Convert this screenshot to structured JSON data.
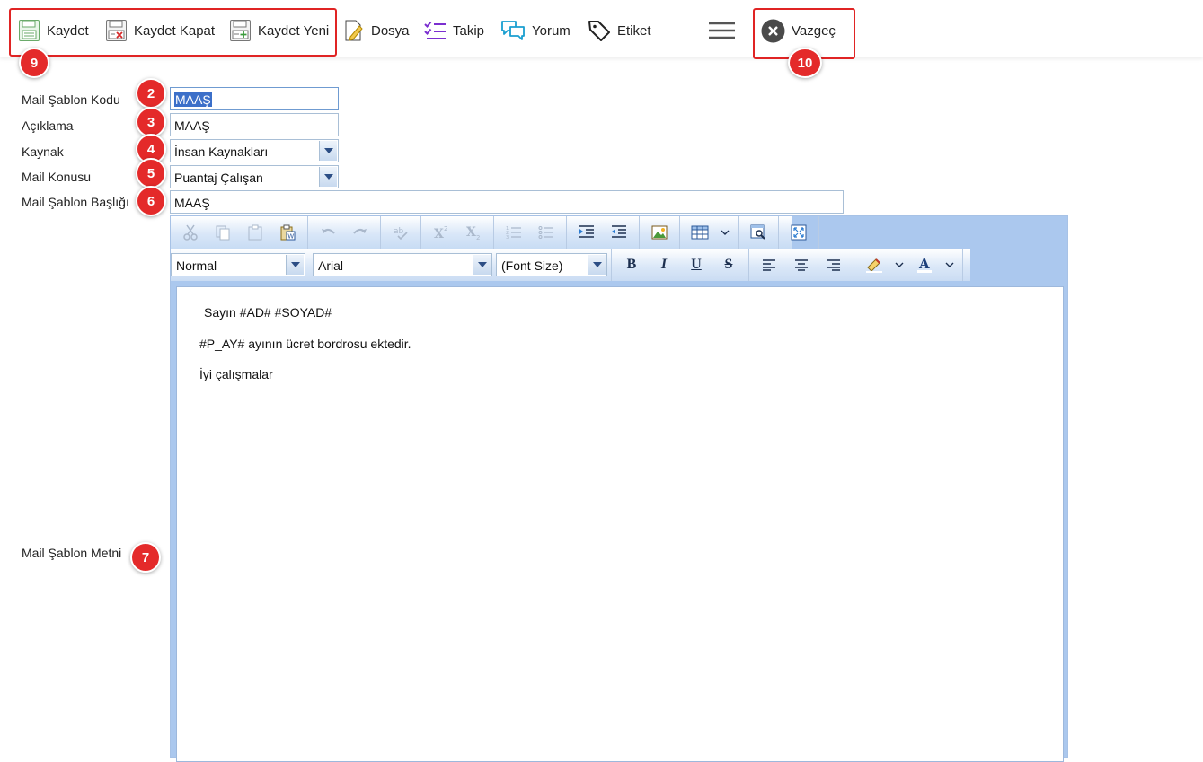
{
  "toolbar": {
    "save_label": "Kaydet",
    "save_close_label": "Kaydet Kapat",
    "save_new_label": "Kaydet Yeni",
    "file_label": "Dosya",
    "follow_label": "Takip",
    "comment_label": "Yorum",
    "tag_label": "Etiket",
    "cancel_label": "Vazgeç"
  },
  "badges": {
    "code": "2",
    "description": "3",
    "source": "4",
    "subject": "5",
    "title": "6",
    "body": "7",
    "save_group": "9",
    "cancel": "10"
  },
  "form": {
    "code_label": "Mail Şablon Kodu",
    "code_value": "MAAŞ",
    "description_label": "Açıklama",
    "description_value": "MAAŞ",
    "source_label": "Kaynak",
    "source_value": "İnsan Kaynakları",
    "subject_label": "Mail Konusu",
    "subject_value": "Puantaj Çalışan",
    "title_label": "Mail Şablon Başlığı",
    "title_value": "MAAŞ",
    "body_label": "Mail Şablon Metni"
  },
  "editor": {
    "format_value": "Normal",
    "font_value": "Arial",
    "size_value": "(Font Size)",
    "lines": [
      "Sayın #AD# #SOYAD#",
      "#P_AY# ayının ücret bordrosu ektedir.",
      "İyi çalışmalar"
    ]
  },
  "colors": {
    "highlight": "#e02424",
    "badge": "#e42a2a",
    "editor_frame": "#abc8ee",
    "selection": "#3b6fc9"
  }
}
